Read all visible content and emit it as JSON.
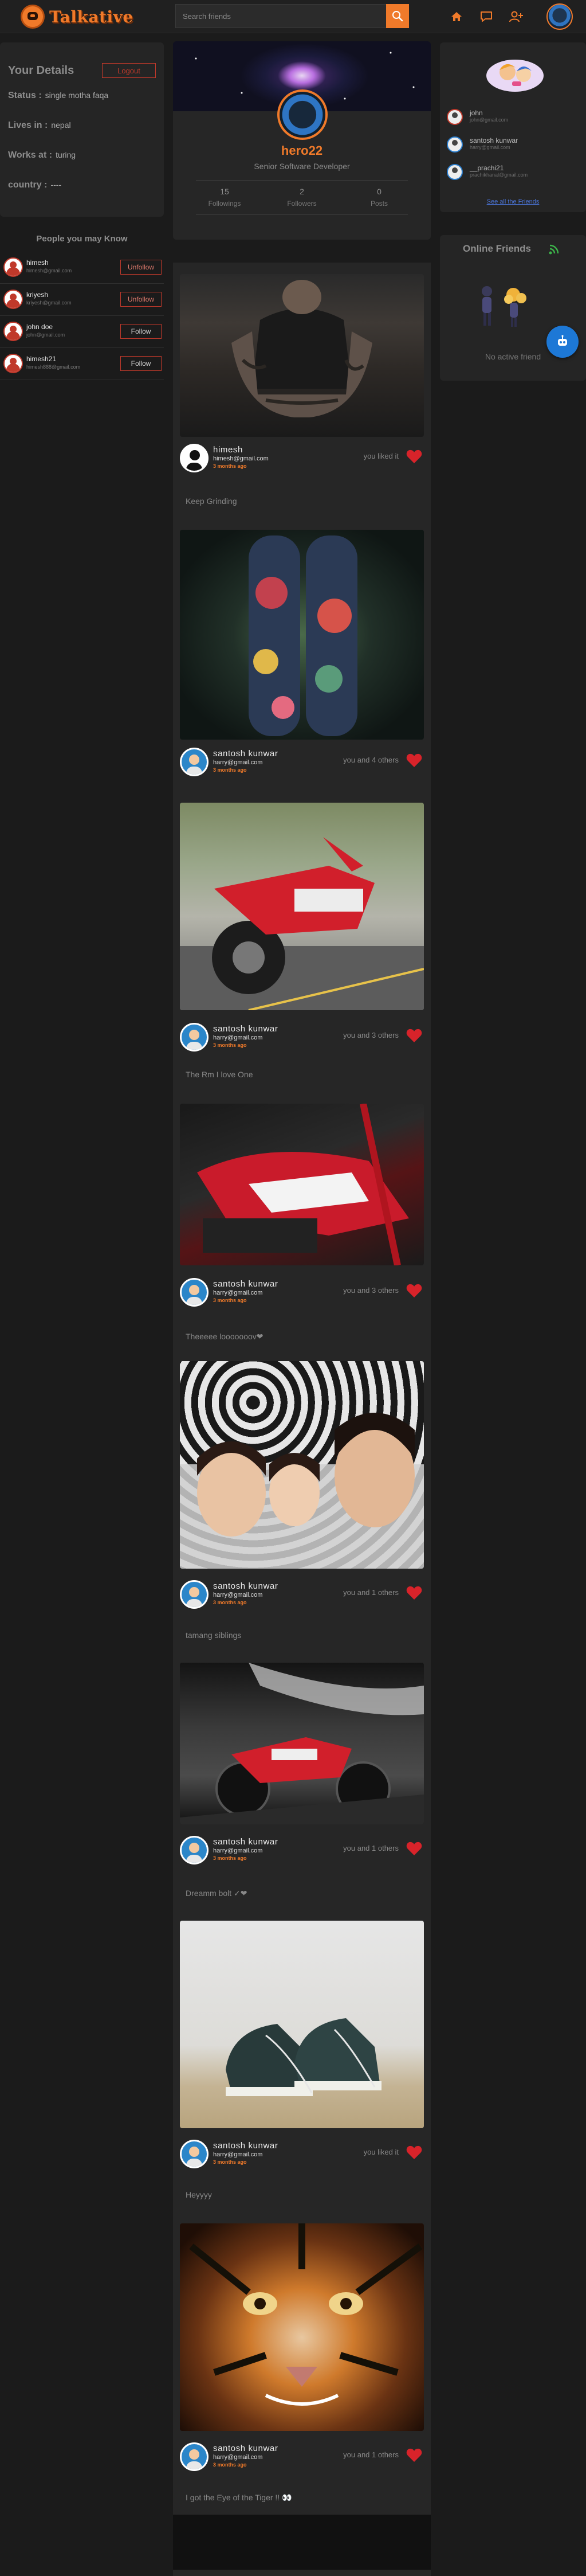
{
  "app": {
    "name": "Talkative"
  },
  "search": {
    "placeholder": "Search friends"
  },
  "details": {
    "title": "Your Details",
    "logout_label": "Logout",
    "rows": [
      {
        "key": "Status :",
        "value": "single motha faqa"
      },
      {
        "key": "Lives in :",
        "value": "nepal"
      },
      {
        "key": "Works at :",
        "value": "turing"
      },
      {
        "key": "country :",
        "value": "----"
      }
    ]
  },
  "people_may_know": {
    "title": "People you may Know",
    "people": [
      {
        "name": "himesh",
        "email": "himesh@gmail.com",
        "action": "Unfollow"
      },
      {
        "name": "kriyesh",
        "email": "kriyesh@gmail.com",
        "action": "Unfollow"
      },
      {
        "name": "john doe",
        "email": "john@gmail.com",
        "action": "Follow"
      },
      {
        "name": "himesh21",
        "email": "himesh888@gmail.com",
        "action": "Follow"
      }
    ]
  },
  "profile": {
    "username": "hero22",
    "title": "Senior Software Developer",
    "stats": [
      {
        "number": "15",
        "label": "Followings"
      },
      {
        "number": "2",
        "label": "Followers"
      },
      {
        "number": "0",
        "label": "Posts"
      }
    ]
  },
  "friends": {
    "list": [
      {
        "name": "john",
        "email": "john@gmail.com",
        "ring": "red"
      },
      {
        "name": "santosh kunwar",
        "email": "harry@gmail.com",
        "ring": "blue"
      },
      {
        "name": "__prachi21",
        "email": "prachikhanal@gmail.com",
        "ring": "blue"
      }
    ],
    "see_all": "See all the Friends"
  },
  "online": {
    "title": "Online Friends",
    "empty_text": "No active friend"
  },
  "posts": [
    {
      "author": "himesh",
      "email": "himesh@gmail.com",
      "time": "3 months ago",
      "likes": "you liked it",
      "caption": "Keep Grinding",
      "image": "tattoo-chest"
    },
    {
      "author": "santosh kunwar",
      "email": "harry@gmail.com",
      "time": "3 months ago",
      "likes": "you and 4 others",
      "caption": "",
      "image": "tattoo-legs"
    },
    {
      "author": "santosh kunwar",
      "email": "harry@gmail.com",
      "time": "3 months ago",
      "likes": "you and 3 others",
      "caption": "The Rm I love One",
      "image": "dirt-bike-road"
    },
    {
      "author": "santosh kunwar",
      "email": "harry@gmail.com",
      "time": "3 months ago",
      "likes": "you and 3 others",
      "caption": "Theeeee looooooov❤",
      "image": "dirt-bike-closeup"
    },
    {
      "author": "santosh kunwar",
      "email": "harry@gmail.com",
      "time": "3 months ago",
      "likes": "you and 1 others",
      "caption": "tamang siblings",
      "image": "three-girls"
    },
    {
      "author": "santosh kunwar",
      "email": "harry@gmail.com",
      "time": "3 months ago",
      "likes": "you and 1 others",
      "caption": "Dreamm bolt ✓❤",
      "image": "dirt-bike-dark"
    },
    {
      "author": "santosh kunwar",
      "email": "harry@gmail.com",
      "time": "3 months ago",
      "likes": "you liked it",
      "caption": "Heyyyy",
      "image": "sneakers"
    },
    {
      "author": "santosh kunwar",
      "email": "harry@gmail.com",
      "time": "3 months ago",
      "likes": "you and 1 others",
      "caption": "I got the Eye of the Tiger !! 👀",
      "image": "tiger"
    }
  ],
  "colors": {
    "accent": "#f07a2a",
    "danger": "#c0392b",
    "link": "#4a73d5",
    "fab": "#1d78d6",
    "online": "#3cb34a"
  }
}
